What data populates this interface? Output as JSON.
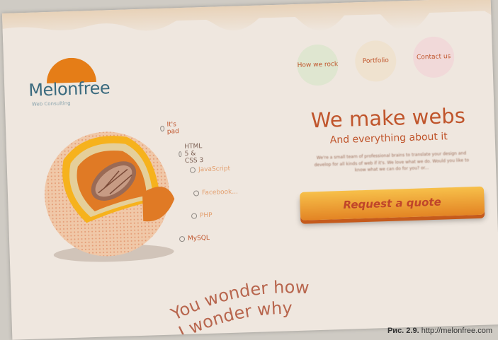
{
  "brand": {
    "name": "Melonfree",
    "tagline": "Web Consulting",
    "colors": {
      "primary": "#c0552c",
      "logo_text": "#3a6a7e",
      "cta": "#f0a030",
      "background": "#efe7df"
    }
  },
  "nav": {
    "items": [
      {
        "label": "How we rock"
      },
      {
        "label": "Portfolio"
      },
      {
        "label": "Contact us"
      }
    ]
  },
  "tech_list": [
    "It's pad",
    "HTML 5 & CSS 3",
    "JavaScript",
    "Facebook...",
    "PHP",
    "MySQL"
  ],
  "hero": {
    "title": "We make webs",
    "subtitle": "And everything about it",
    "blurb": "We're a small team of professional brains to translate your design and develop for all kinds of web if it's. We love what we do. Would you like to know what we can do for you? or...",
    "cta_label": "Request a quote"
  },
  "ribbon": {
    "line1": "You wonder how",
    "line2": "I wonder why"
  },
  "caption": {
    "figure": "Рис. 2.9.",
    "url": "http://melonfree.com"
  },
  "icons": [
    "melon-illustration",
    "logo-arc-icon",
    "bullet-dot-icon"
  ]
}
